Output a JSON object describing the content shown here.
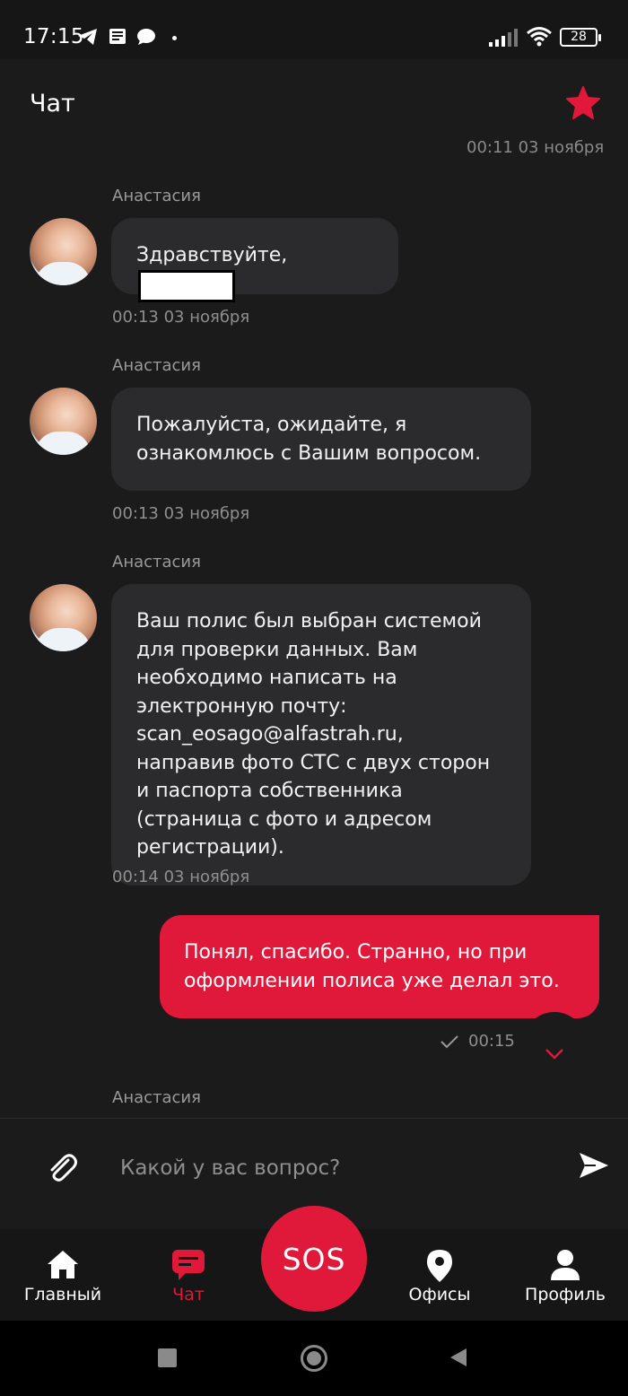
{
  "status_bar": {
    "time": "17:15",
    "battery": "28",
    "icons": [
      "telegram-icon",
      "news-icon",
      "message-icon",
      "signal-icon",
      "wifi-icon",
      "battery-icon"
    ]
  },
  "header": {
    "title": "Чат",
    "favorite_icon": "star-icon"
  },
  "chat": {
    "partial_timestamp": "00:11 03 ноября",
    "messages": [
      {
        "sender": "Анастасия",
        "text": "Здравствуйте,",
        "time": "00:13 03 ноября",
        "direction": "in",
        "redacted": true
      },
      {
        "sender": "Анастасия",
        "text": "Пожалуйста, ожидайте, я ознакомлюсь с Вашим вопросом.",
        "time": "00:13 03 ноября",
        "direction": "in"
      },
      {
        "sender": "Анастасия",
        "text": "Ваш полис был выбран системой для проверки данных. Вам необходимо написать на электронную почту: scan_eosago@alfastrah.ru, направив фото СТС с двух сторон и паспорта собственника (страница с фото и адресом регистрации).",
        "time": "00:14 03 ноября",
        "direction": "in"
      },
      {
        "sender": "",
        "text": "Понял, спасибо. Странно, но при оформлении полиса уже делал это.",
        "time": "00:15",
        "direction": "out",
        "status": "sent"
      },
      {
        "sender": "Анастасия",
        "direction": "in"
      }
    ]
  },
  "input": {
    "placeholder": "Какой у вас вопрос?"
  },
  "nav": {
    "items": [
      {
        "label": "Главный",
        "icon": "home-icon"
      },
      {
        "label": "Чат",
        "icon": "chat-icon",
        "active": true
      },
      {
        "label": "SOS",
        "icon": "sos-button"
      },
      {
        "label": "Офисы",
        "icon": "location-pin-icon"
      },
      {
        "label": "Профиль",
        "icon": "user-icon"
      }
    ]
  },
  "colors": {
    "accent": "#e0193a",
    "background": "#1b1b1b",
    "bubble_in": "#2b2b2d"
  }
}
